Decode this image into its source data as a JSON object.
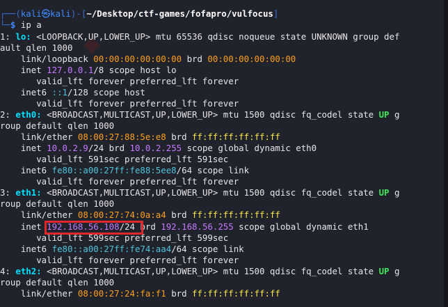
{
  "prompt": {
    "user": "kali",
    "at": "㉿",
    "host": "kali",
    "path": "~/Desktop/ctf-games/fofapro/vulfocus",
    "command": "ip a"
  },
  "output": {
    "lo_idx": "1:",
    "lo_name": "lo:",
    "lo_rest": " <LOOPBACK,UP,LOWER_UP> mtu 65536 qdisc noqueue state UNKNOWN group def",
    "lo_wrap": "ault qlen 1000",
    "lo_link_pre": "    link/loopback ",
    "lo_mac": "00:00:00:00:00:00",
    "lo_brd": " brd ",
    "lo_brdmac": "00:00:00:00:00:00",
    "lo_inet_pre": "    inet ",
    "lo_ip": "127.0.0.1",
    "lo_inet_post": "/8 scope host lo",
    "lo_valid": "       valid_lft forever preferred_lft forever",
    "lo_inet6_pre": "    inet6 ",
    "lo_ip6": "::1",
    "lo_inet6_post": "/128 scope host",
    "lo_valid6": "       valid_lft forever preferred_lft forever",
    "e0_idx": "2:",
    "e0_name": "eth0:",
    "e0_rest": " <BROADCAST,MULTICAST,UP,LOWER_UP> mtu 1500 qdisc fq_codel state ",
    "e0_state": "UP",
    "e0_tail": " g",
    "e0_wrap": "roup default qlen 1000",
    "e0_link_pre": "    link/ether ",
    "e0_mac": "08:00:27:88:5e:e8",
    "e0_brd": " brd ",
    "e0_brdmac": "ff:ff:ff:ff:ff:ff",
    "e0_inet_pre": "    inet ",
    "e0_ip": "10.0.2.9",
    "e0_inet_mid": "/24 brd ",
    "e0_bcast": "10.0.2.255",
    "e0_inet_post": " scope global dynamic eth0",
    "e0_valid": "       valid_lft 591sec preferred_lft 591sec",
    "e0_inet6_pre": "    inet6 ",
    "e0_ip6": "fe80::a00:27ff:fe88:5ee8",
    "e0_inet6_post": "/64 scope link",
    "e0_valid6": "       valid_lft forever preferred_lft forever",
    "e1_idx": "3:",
    "e1_name": "eth1:",
    "e1_rest": " <BROADCAST,MULTICAST,UP,LOWER_UP> mtu 1500 qdisc fq_codel state ",
    "e1_state": "UP",
    "e1_tail": " g",
    "e1_wrap": "roup default qlen 1000",
    "e1_link_pre": "    link/ether ",
    "e1_mac": "08:00:27:74:0a:a4",
    "e1_brd": " brd ",
    "e1_brdmac": "ff:ff:ff:ff:ff:ff",
    "e1_inet_pre": "    inet ",
    "e1_ip": "192.168.56.108",
    "e1_inet_mid": "/24 brd ",
    "e1_bcast": "192.168.56.255",
    "e1_inet_post": " scope global dynamic eth1",
    "e1_valid": "       valid_lft 599sec preferred_lft 599sec",
    "e1_inet6_pre": "    inet6 ",
    "e1_ip6": "fe80::a00:27ff:fe74:aa4",
    "e1_inet6_post": "/64 scope link",
    "e1_valid6": "       valid_lft forever preferred_lft forever",
    "e2_idx": "4:",
    "e2_name": "eth2:",
    "e2_rest": " <BROADCAST,MULTICAST,UP,LOWER_UP> mtu 1500 qdisc fq_codel state ",
    "e2_state": "UP",
    "e2_tail": " g",
    "e2_wrap": "roup default qlen 1000",
    "e2_link_pre": "    link/ether ",
    "e2_mac": "08:00:27:24:fa:f1",
    "e2_brd": " brd ",
    "e2_brdmac": "ff:ff:ff:ff:ff:ff"
  },
  "left_edge_chars": [
    "t",
    "r",
    "r"
  ],
  "colors": {
    "background": "#20232c",
    "prompt_blue": "#3f8cff",
    "mac_orange": "#ff9f1a",
    "ip_purple": "#c678ff",
    "state_green": "#3fe65a",
    "broadcast_yellow": "#ffe94a",
    "highlight_red": "#e0282c"
  }
}
